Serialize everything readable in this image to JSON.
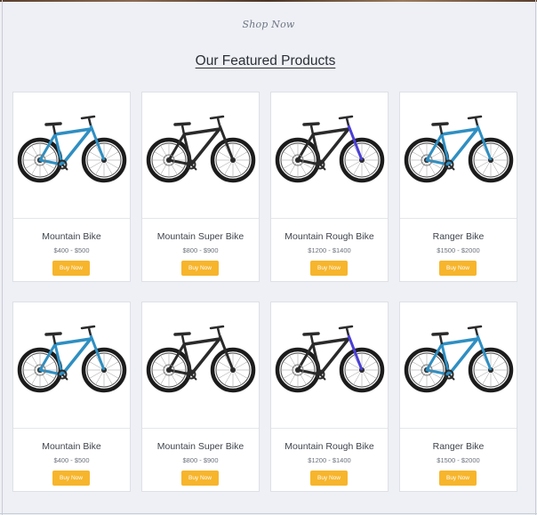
{
  "header": {
    "shop_now": "Shop Now",
    "title": "Our Featured Products"
  },
  "colors": {
    "page_bg": "#eef0f5",
    "button_bg": "#f7b52c",
    "bike_blue": "#2f8fc2",
    "bike_black": "#2a2a2a",
    "bike_purple": "#4a3fd6"
  },
  "products": [
    {
      "name": "Mountain Bike",
      "price": "$400 - $500",
      "button": "Buy Now",
      "style": "blue"
    },
    {
      "name": "Mountain Super Bike",
      "price": "$800 - $900",
      "button": "Buy Now",
      "style": "black"
    },
    {
      "name": "Mountain Rough Bike",
      "price": "$1200 - $1400",
      "button": "Buy Now",
      "style": "purple"
    },
    {
      "name": "Ranger Bike",
      "price": "$1500 - $2000",
      "button": "Buy Now",
      "style": "blue"
    },
    {
      "name": "Mountain Bike",
      "price": "$400 - $500",
      "button": "Buy Now",
      "style": "blue"
    },
    {
      "name": "Mountain Super Bike",
      "price": "$800 - $900",
      "button": "Buy Now",
      "style": "black"
    },
    {
      "name": "Mountain Rough Bike",
      "price": "$1200 - $1400",
      "button": "Buy Now",
      "style": "purple"
    },
    {
      "name": "Ranger Bike",
      "price": "$1500 - $2000",
      "button": "Buy Now",
      "style": "blue"
    }
  ]
}
